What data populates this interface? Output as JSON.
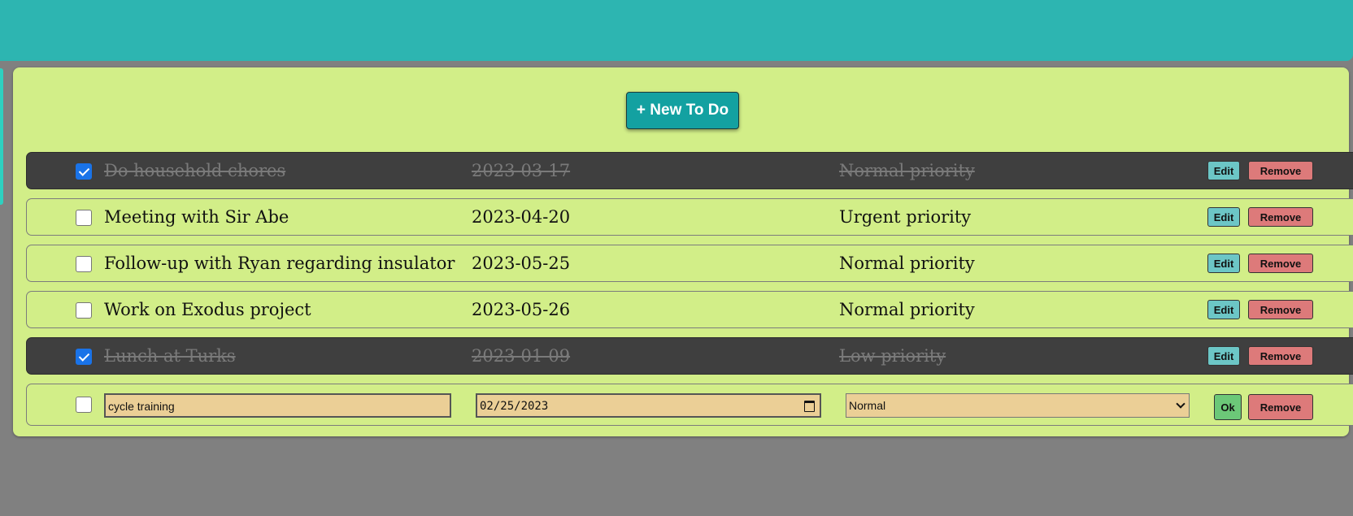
{
  "toolbar": {
    "new_todo_label": "+ New To Do"
  },
  "todos": [
    {
      "completed": true,
      "title": "Do household chores",
      "date": "2023-03-17",
      "priority": "Normal priority",
      "edit_label": "Edit",
      "remove_label": "Remove"
    },
    {
      "completed": false,
      "title": "Meeting with Sir Abe",
      "date": "2023-04-20",
      "priority": "Urgent priority",
      "edit_label": "Edit",
      "remove_label": "Remove"
    },
    {
      "completed": false,
      "title": "Follow-up with Ryan regarding insulator",
      "date": "2023-05-25",
      "priority": "Normal priority",
      "edit_label": "Edit",
      "remove_label": "Remove"
    },
    {
      "completed": false,
      "title": "Work on Exodus project",
      "date": "2023-05-26",
      "priority": "Normal priority",
      "edit_label": "Edit",
      "remove_label": "Remove"
    },
    {
      "completed": true,
      "title": "Lunch at Turks",
      "date": "2023-01-09",
      "priority": "Low priority",
      "edit_label": "Edit",
      "remove_label": "Remove"
    }
  ],
  "editing_row": {
    "completed": false,
    "title_value": "cycle training",
    "date_value": "02/25/2023",
    "priority_value": "Normal",
    "ok_label": "Ok",
    "remove_label": "Remove"
  },
  "colors": {
    "header": "#2db5b1",
    "panel": "#d2ee88",
    "completed_row": "#3f3f3f",
    "new_button": "#13a1a1",
    "edit_button": "#6cc6c6",
    "remove_button": "#dd7a7a",
    "ok_button": "#6cc878",
    "edit_field": "#ebcf96"
  }
}
